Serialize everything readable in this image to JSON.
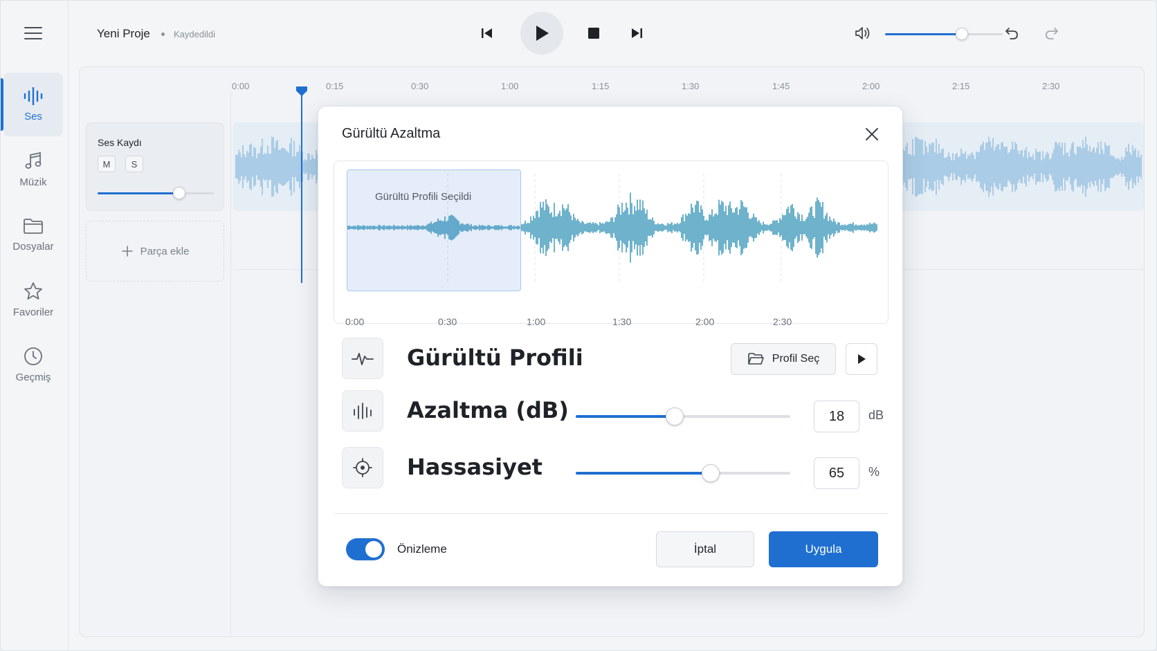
{
  "app": {
    "project_title": "Yeni Proje",
    "save_status": "Kaydedildi"
  },
  "sidebar": {
    "items": [
      {
        "label": "Ses",
        "icon": "waveform-icon",
        "active": true
      },
      {
        "label": "Müzik",
        "icon": "music-note-icon",
        "active": false
      },
      {
        "label": "Dosyalar",
        "icon": "folder-icon",
        "active": false
      },
      {
        "label": "Favoriler",
        "icon": "star-icon",
        "active": false
      },
      {
        "label": "Geçmiş",
        "icon": "clock-icon",
        "active": false
      }
    ]
  },
  "transport": {
    "volume_level": 0.65
  },
  "timeline": {
    "ruler_ticks": [
      "0:00",
      "0:15",
      "0:30",
      "1:00",
      "1:15",
      "1:30",
      "1:45",
      "2:00",
      "2:15",
      "2:30"
    ]
  },
  "track": {
    "name": "Ses Kaydı",
    "mute_label": "M",
    "solo_label": "S",
    "volume_level": 0.7,
    "add_track_label": "Parça ekle"
  },
  "dialog": {
    "title": "Gürültü Azaltma",
    "selection_label": "Gürültü Profili Seçildi",
    "wave_ticks": [
      "0:00",
      "0:30",
      "1:00",
      "1:30",
      "2:00",
      "2:30"
    ],
    "profile": {
      "label": "Gürültü Profili",
      "select_button": "Profil Seç"
    },
    "reduction": {
      "label": "Azaltma (dB)",
      "value": "18",
      "unit": "dB",
      "level": 0.46
    },
    "sensitivity": {
      "label": "Hassasiyet",
      "value": "65",
      "unit": "%",
      "level": 0.63
    },
    "preview_label": "Önizleme",
    "preview_on": true,
    "cancel_label": "İptal",
    "apply_label": "Uygula"
  },
  "colors": {
    "accent": "#1f6fd1",
    "wave_dialog": "#4a9fbf",
    "wave_track": "#9cc4e2"
  }
}
